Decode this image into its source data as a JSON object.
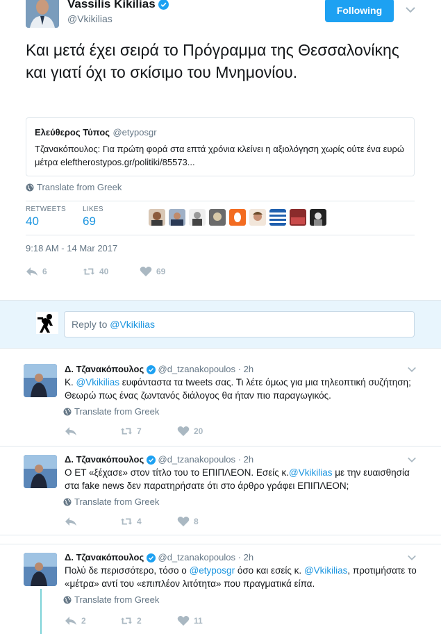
{
  "main_tweet": {
    "author_name": "Vassilis Kikilias",
    "author_handle": "@Vkikilias",
    "follow_label": "Following",
    "text": "Και μετά έχει σειρά το Πρόγραμμα της Θεσσαλονίκης και γιατί όχι το σκίσιμο του Μνημονίου.",
    "quote": {
      "name": "Ελεύθερος Τύπος",
      "handle": "@etyposgr",
      "text": "Τζανακόπουλος: Για πρώτη φορά στα επτά χρόνια κλείνει η αξιολόγηση χωρίς ούτε ένα ευρώ μέτρα eleftherostypos.gr/politiki/85573..."
    },
    "translate_label": "Translate from Greek",
    "retweets_label": "RETWEETS",
    "retweets_count": "40",
    "likes_label": "LIKES",
    "likes_count": "69",
    "timestamp": "9:18 AM - 14 Mar 2017",
    "actions": {
      "replies": "6",
      "retweets": "40",
      "likes": "69"
    }
  },
  "reply_box": {
    "prefix": "Reply to ",
    "mention": "@Vkikilias"
  },
  "replies": [
    {
      "name": "Δ. Τζανακόπουλος",
      "handle": "@d_tzanakopoulos",
      "time": "2h",
      "text_parts": [
        "Κ. ",
        "@Vkikilias",
        " ευφάνταστα τα tweets σας. Τι λέτε όμως για μια τηλεοπτική συζήτηση; Θεωρώ πως ένας ζωντανός διάλογος θα ήταν πιο παραγωγικός."
      ],
      "translate_label": "Translate from Greek",
      "actions": {
        "replies": "",
        "retweets": "7",
        "likes": "20"
      }
    },
    {
      "name": "Δ. Τζανακόπουλος",
      "handle": "@d_tzanakopoulos",
      "time": "2h",
      "text_parts": [
        "Ο ΕΤ «ξέχασε» στον τίτλο του το ΕΠΙΠΛΕΟΝ. Εσείς κ.",
        "@Vkikilias",
        " με την ευαισθησία στα fake news δεν παρατηρήσατε ότι στο άρθρο γράφει ΕΠΙΠΛΕΟΝ;"
      ],
      "translate_label": "Translate from Greek",
      "actions": {
        "replies": "",
        "retweets": "4",
        "likes": "8"
      }
    },
    {
      "name": "Δ. Τζανακόπουλος",
      "handle": "@d_tzanakopoulos",
      "time": "2h",
      "text_parts": [
        "Πολύ δε περισσότερο, τόσο ο ",
        "@etyposgr",
        " όσο και εσείς κ. ",
        "@Vkikilias",
        ", προτιμήσατε το «μέτρα» αντί του «επιπλέον λιτότητα» που πραγματικά είπα."
      ],
      "translate_label": "Translate from Greek",
      "actions": {
        "replies": "2",
        "retweets": "2",
        "likes": "11"
      }
    }
  ],
  "colors": {
    "accent": "#1da1f2",
    "link": "#1b95e0",
    "muted": "#657786",
    "action_gray": "#aab8c2",
    "reply_bg": "#e8f5fd"
  }
}
